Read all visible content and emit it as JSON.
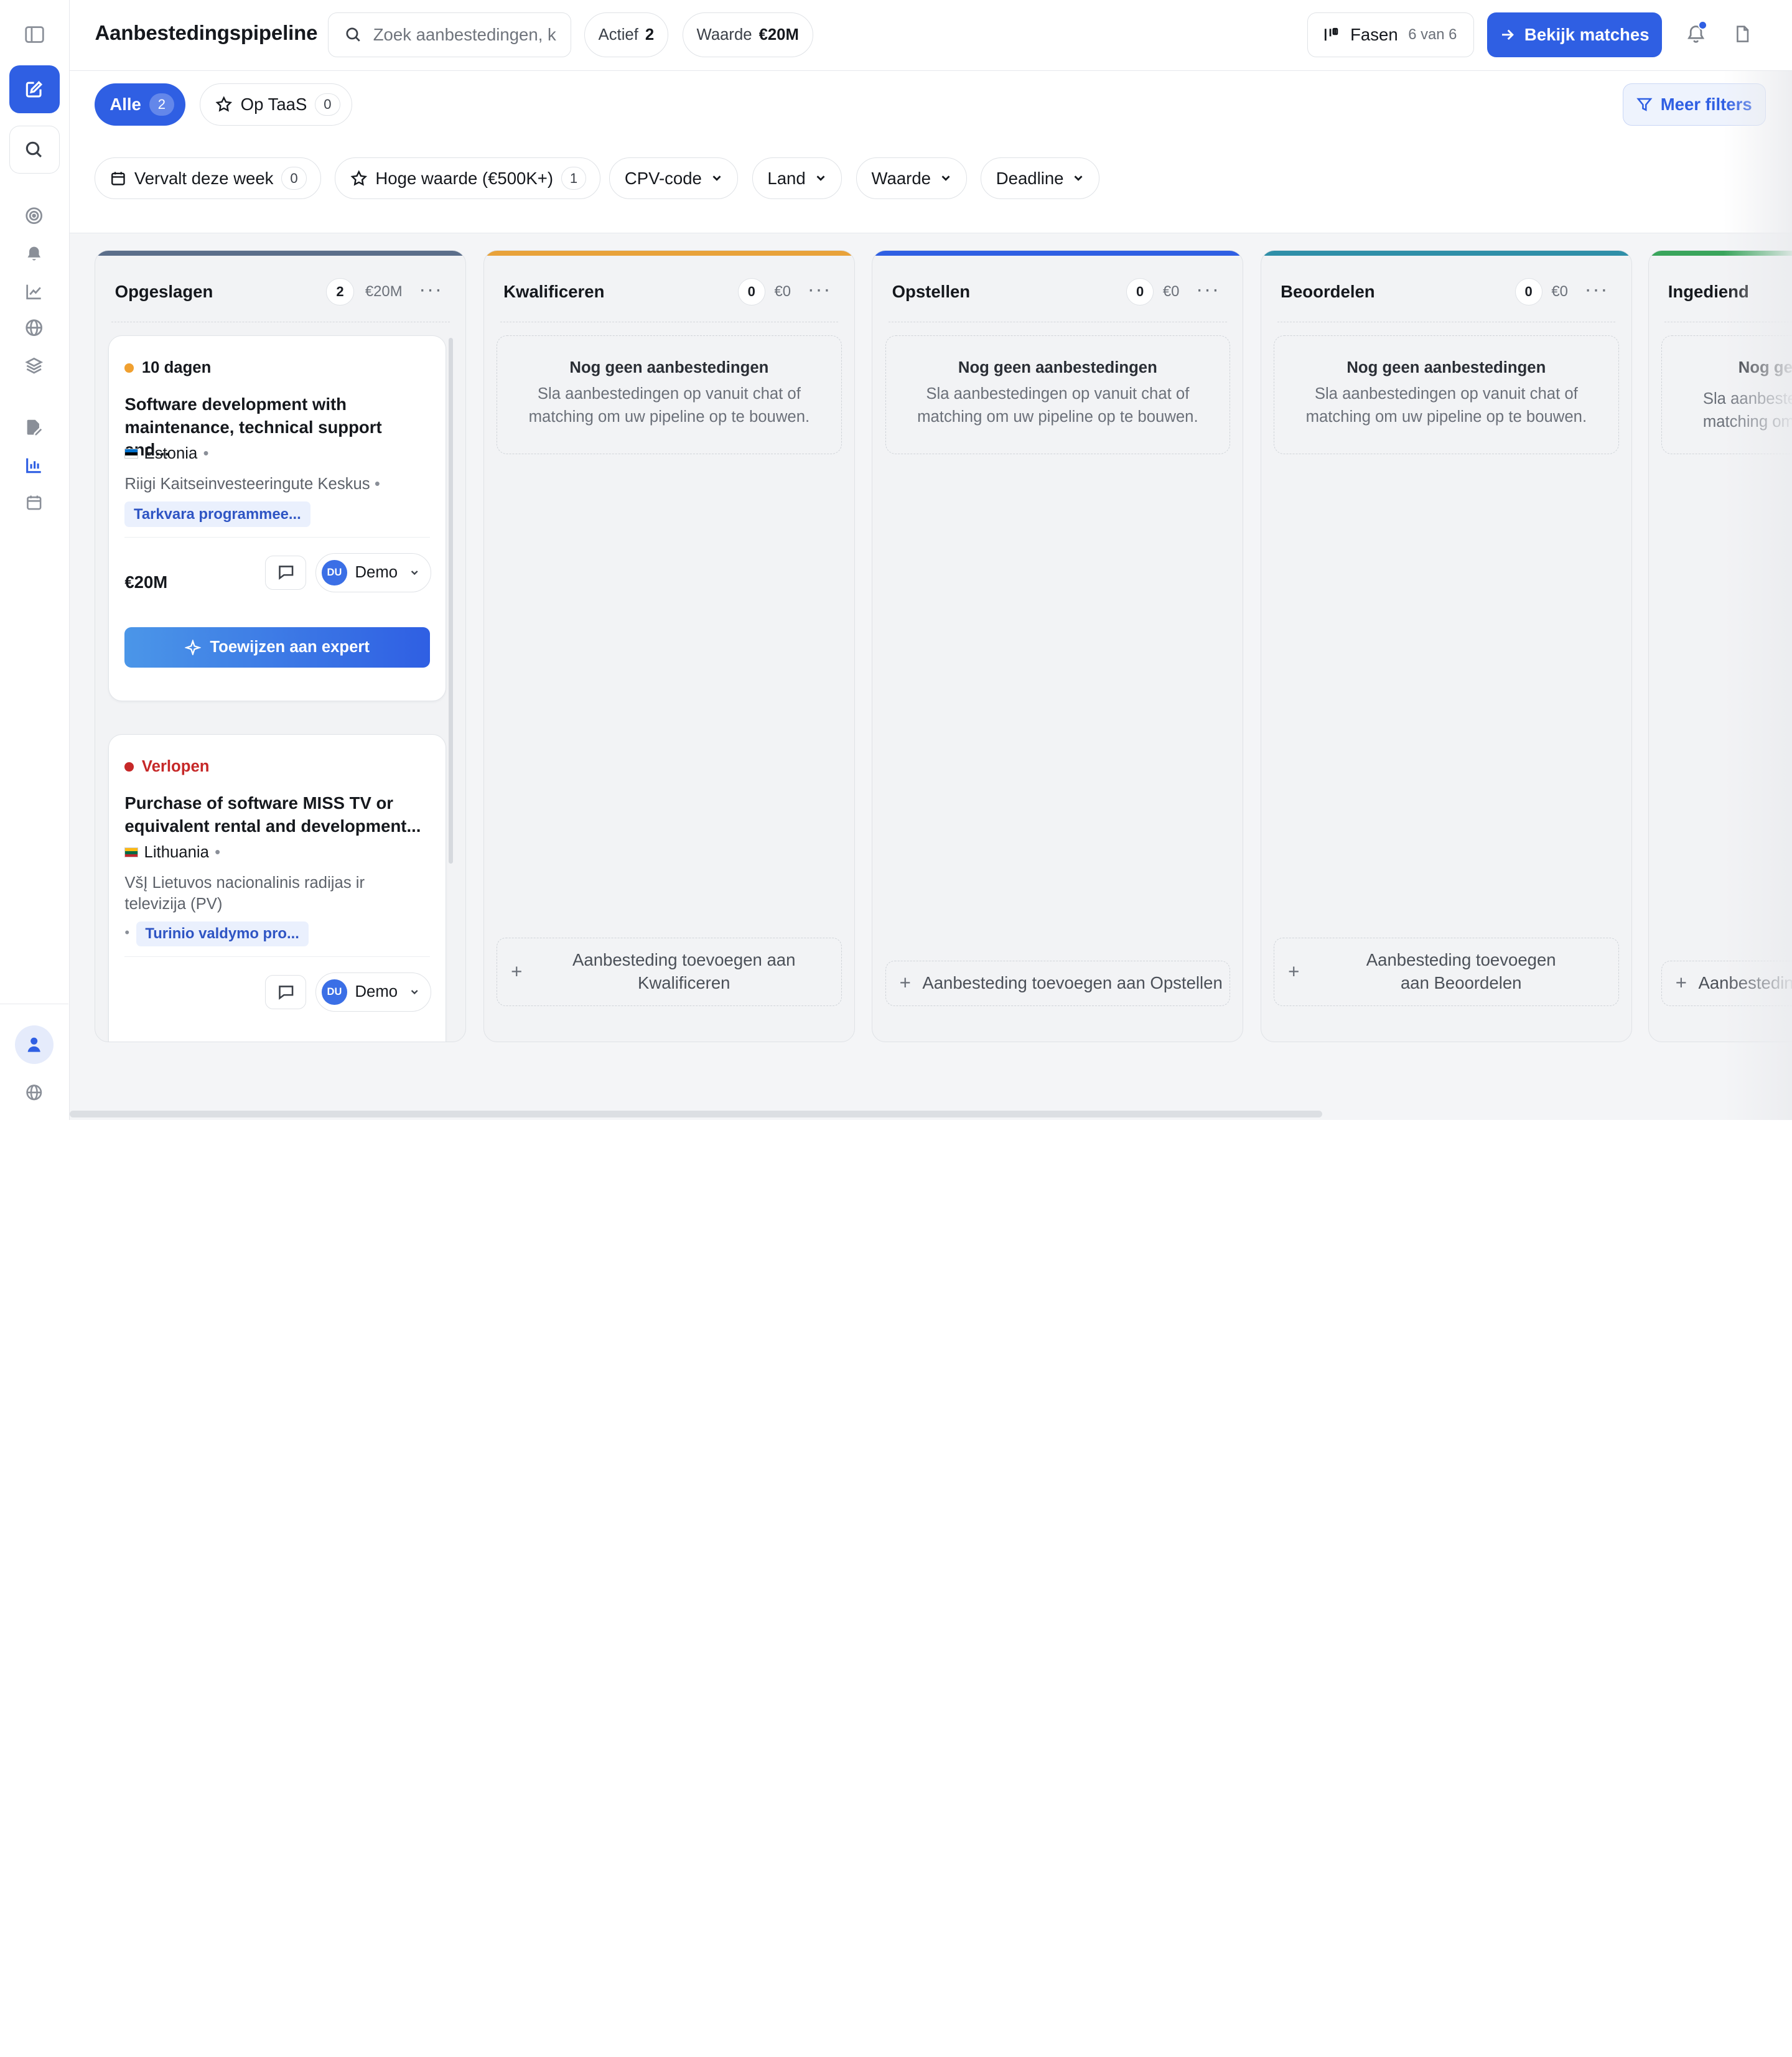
{
  "header": {
    "title": "Aanbestedingspipeline",
    "search_placeholder": "Zoek aanbestedingen, k",
    "active_label": "Actief",
    "active_count": "2",
    "value_label": "Waarde",
    "value_amount": "€20M",
    "phases_label": "Fasen",
    "phases_count": "6 van 6",
    "matches_button": "Bekijk matches"
  },
  "segments": [
    {
      "label": "Alle",
      "count": "2"
    },
    {
      "label": "Op TaaS",
      "count": "0"
    }
  ],
  "more_filters": "Meer filters",
  "filter_chips": [
    {
      "label": "Vervalt deze week",
      "count": "0"
    },
    {
      "label": "Hoge waarde (€500K+)",
      "count": "1"
    },
    {
      "label": "CPV-code"
    },
    {
      "label": "Land"
    },
    {
      "label": "Waarde"
    },
    {
      "label": "Deadline"
    }
  ],
  "columns": [
    {
      "title": "Opgeslagen",
      "count": "2",
      "value": "€20M",
      "color": "#5b6e8a"
    },
    {
      "title": "Kwalificeren",
      "count": "0",
      "value": "€0",
      "color": "#e8a23a"
    },
    {
      "title": "Opstellen",
      "count": "0",
      "value": "€0",
      "color": "#2f5fe3"
    },
    {
      "title": "Beoordelen",
      "count": "0",
      "value": "€0",
      "color": "#2f8fa8"
    },
    {
      "title": "Ingediend",
      "color": "#3aa55c"
    }
  ],
  "empty_state": {
    "title": "Nog geen aanbestedingen",
    "subtitle": "Sla aanbestedingen op vanuit chat of matching om uw pipeline op te bouwen.",
    "title_clipped": "Nog ge",
    "subtitle_clipped": "Sla aanbeste matching om"
  },
  "add_buttons": {
    "kwalificeren": "Aanbesteding toevoegen aan Kwalificeren",
    "opstellen": "Aanbesteding toevoegen aan Opstellen",
    "beoordelen": "Aanbesteding toevoegen aan Beoordelen",
    "ingediend_clipped": "Aanbestedin"
  },
  "cards": [
    {
      "deadline": "10 dagen",
      "deadline_color": "#f0a030",
      "title": "Software development with maintenance, technical support and...",
      "country": "Estonia",
      "buyer": "Riigi Kaitseinvesteeringute Keskus",
      "tag": "Tarkvara programmee...",
      "value": "€20M",
      "assignee_initials": "DU",
      "assignee_name": "Demo",
      "expert_button": "Toewijzen aan expert"
    },
    {
      "deadline": "Verlopen",
      "deadline_color": "#c62828",
      "title": "Purchase of software MISS TV or equivalent rental and development...",
      "country": "Lithuania",
      "buyer": "VšĮ Lietuvos nacionalinis radijas ir televizija (PV)",
      "tag": "Turinio valdymo pro...",
      "assignee_initials": "DU",
      "assignee_name": "Demo"
    }
  ],
  "colors": {
    "accent": "#2f5fe3"
  }
}
